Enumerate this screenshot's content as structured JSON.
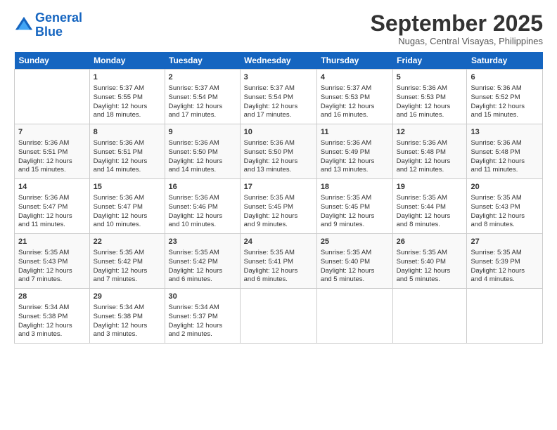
{
  "header": {
    "logo_line1": "General",
    "logo_line2": "Blue",
    "month": "September 2025",
    "location": "Nugas, Central Visayas, Philippines"
  },
  "weekdays": [
    "Sunday",
    "Monday",
    "Tuesday",
    "Wednesday",
    "Thursday",
    "Friday",
    "Saturday"
  ],
  "weeks": [
    [
      {
        "day": "",
        "text": ""
      },
      {
        "day": "1",
        "text": "Sunrise: 5:37 AM\nSunset: 5:55 PM\nDaylight: 12 hours\nand 18 minutes."
      },
      {
        "day": "2",
        "text": "Sunrise: 5:37 AM\nSunset: 5:54 PM\nDaylight: 12 hours\nand 17 minutes."
      },
      {
        "day": "3",
        "text": "Sunrise: 5:37 AM\nSunset: 5:54 PM\nDaylight: 12 hours\nand 17 minutes."
      },
      {
        "day": "4",
        "text": "Sunrise: 5:37 AM\nSunset: 5:53 PM\nDaylight: 12 hours\nand 16 minutes."
      },
      {
        "day": "5",
        "text": "Sunrise: 5:36 AM\nSunset: 5:53 PM\nDaylight: 12 hours\nand 16 minutes."
      },
      {
        "day": "6",
        "text": "Sunrise: 5:36 AM\nSunset: 5:52 PM\nDaylight: 12 hours\nand 15 minutes."
      }
    ],
    [
      {
        "day": "7",
        "text": "Sunrise: 5:36 AM\nSunset: 5:51 PM\nDaylight: 12 hours\nand 15 minutes."
      },
      {
        "day": "8",
        "text": "Sunrise: 5:36 AM\nSunset: 5:51 PM\nDaylight: 12 hours\nand 14 minutes."
      },
      {
        "day": "9",
        "text": "Sunrise: 5:36 AM\nSunset: 5:50 PM\nDaylight: 12 hours\nand 14 minutes."
      },
      {
        "day": "10",
        "text": "Sunrise: 5:36 AM\nSunset: 5:50 PM\nDaylight: 12 hours\nand 13 minutes."
      },
      {
        "day": "11",
        "text": "Sunrise: 5:36 AM\nSunset: 5:49 PM\nDaylight: 12 hours\nand 13 minutes."
      },
      {
        "day": "12",
        "text": "Sunrise: 5:36 AM\nSunset: 5:48 PM\nDaylight: 12 hours\nand 12 minutes."
      },
      {
        "day": "13",
        "text": "Sunrise: 5:36 AM\nSunset: 5:48 PM\nDaylight: 12 hours\nand 11 minutes."
      }
    ],
    [
      {
        "day": "14",
        "text": "Sunrise: 5:36 AM\nSunset: 5:47 PM\nDaylight: 12 hours\nand 11 minutes."
      },
      {
        "day": "15",
        "text": "Sunrise: 5:36 AM\nSunset: 5:47 PM\nDaylight: 12 hours\nand 10 minutes."
      },
      {
        "day": "16",
        "text": "Sunrise: 5:36 AM\nSunset: 5:46 PM\nDaylight: 12 hours\nand 10 minutes."
      },
      {
        "day": "17",
        "text": "Sunrise: 5:35 AM\nSunset: 5:45 PM\nDaylight: 12 hours\nand 9 minutes."
      },
      {
        "day": "18",
        "text": "Sunrise: 5:35 AM\nSunset: 5:45 PM\nDaylight: 12 hours\nand 9 minutes."
      },
      {
        "day": "19",
        "text": "Sunrise: 5:35 AM\nSunset: 5:44 PM\nDaylight: 12 hours\nand 8 minutes."
      },
      {
        "day": "20",
        "text": "Sunrise: 5:35 AM\nSunset: 5:43 PM\nDaylight: 12 hours\nand 8 minutes."
      }
    ],
    [
      {
        "day": "21",
        "text": "Sunrise: 5:35 AM\nSunset: 5:43 PM\nDaylight: 12 hours\nand 7 minutes."
      },
      {
        "day": "22",
        "text": "Sunrise: 5:35 AM\nSunset: 5:42 PM\nDaylight: 12 hours\nand 7 minutes."
      },
      {
        "day": "23",
        "text": "Sunrise: 5:35 AM\nSunset: 5:42 PM\nDaylight: 12 hours\nand 6 minutes."
      },
      {
        "day": "24",
        "text": "Sunrise: 5:35 AM\nSunset: 5:41 PM\nDaylight: 12 hours\nand 6 minutes."
      },
      {
        "day": "25",
        "text": "Sunrise: 5:35 AM\nSunset: 5:40 PM\nDaylight: 12 hours\nand 5 minutes."
      },
      {
        "day": "26",
        "text": "Sunrise: 5:35 AM\nSunset: 5:40 PM\nDaylight: 12 hours\nand 5 minutes."
      },
      {
        "day": "27",
        "text": "Sunrise: 5:35 AM\nSunset: 5:39 PM\nDaylight: 12 hours\nand 4 minutes."
      }
    ],
    [
      {
        "day": "28",
        "text": "Sunrise: 5:34 AM\nSunset: 5:38 PM\nDaylight: 12 hours\nand 3 minutes."
      },
      {
        "day": "29",
        "text": "Sunrise: 5:34 AM\nSunset: 5:38 PM\nDaylight: 12 hours\nand 3 minutes."
      },
      {
        "day": "30",
        "text": "Sunrise: 5:34 AM\nSunset: 5:37 PM\nDaylight: 12 hours\nand 2 minutes."
      },
      {
        "day": "",
        "text": ""
      },
      {
        "day": "",
        "text": ""
      },
      {
        "day": "",
        "text": ""
      },
      {
        "day": "",
        "text": ""
      }
    ]
  ]
}
